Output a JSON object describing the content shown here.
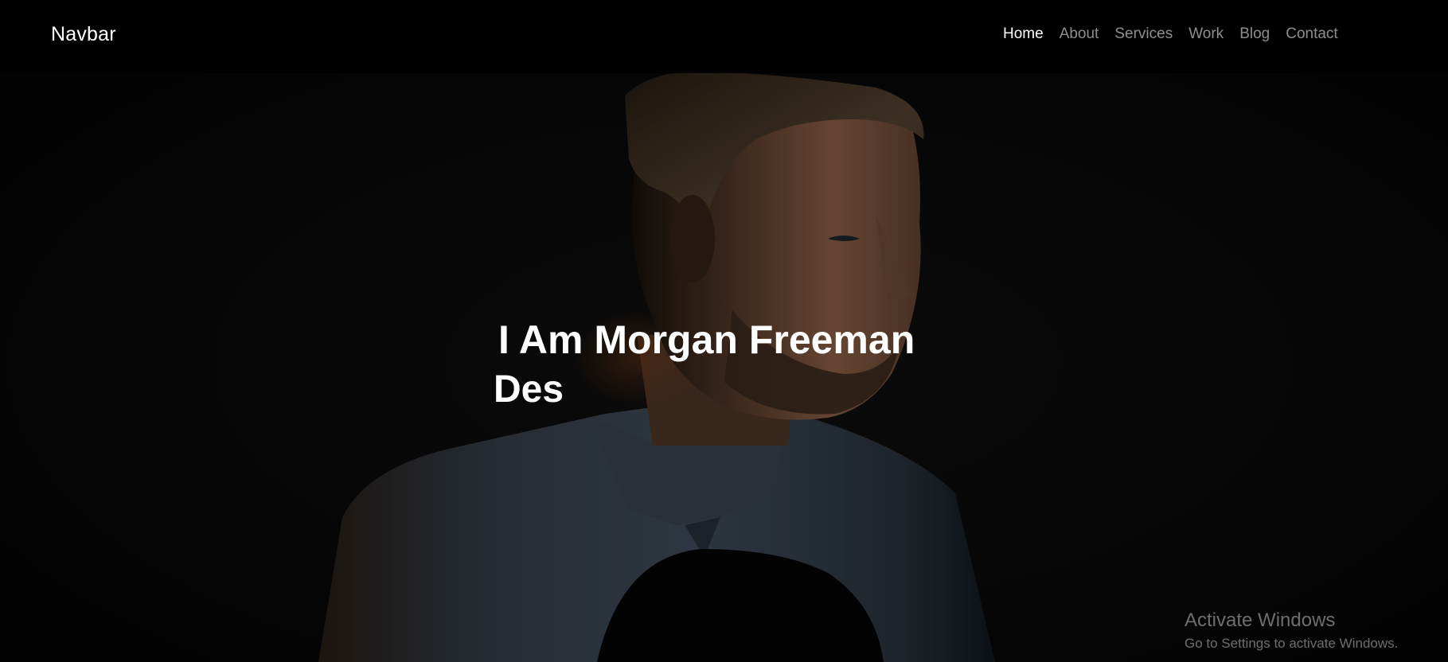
{
  "navbar": {
    "brand": "Navbar",
    "links": [
      {
        "label": "Home",
        "active": true
      },
      {
        "label": "About",
        "active": false
      },
      {
        "label": "Services",
        "active": false
      },
      {
        "label": "Work",
        "active": false
      },
      {
        "label": "Blog",
        "active": false
      },
      {
        "label": "Contact",
        "active": false
      }
    ]
  },
  "hero": {
    "title": "I Am Morgan Freeman",
    "typed_text": "Des"
  },
  "watermark": {
    "title": "Activate Windows",
    "subtitle": "Go to Settings to activate Windows."
  },
  "colors": {
    "background": "#070707",
    "navbar_background": "#000000",
    "text_primary": "#ffffff",
    "nav_inactive": "#8c8c8c",
    "shirt_denim": "#3d4a58",
    "skin_warm": "#9c6a4e"
  }
}
